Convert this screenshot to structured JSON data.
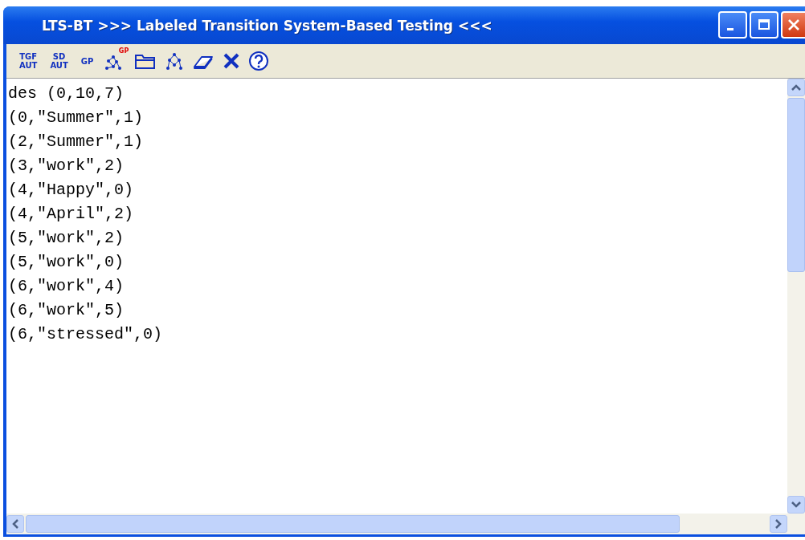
{
  "window": {
    "title": "LTS-BT >>> Labeled Transition System-Based Testing <<<"
  },
  "toolbar": [
    {
      "kind": "text",
      "lines": [
        "TGF",
        "AUT"
      ]
    },
    {
      "kind": "text",
      "lines": [
        "SD",
        "AUT"
      ]
    },
    {
      "kind": "text",
      "lines": [
        "GP"
      ]
    },
    {
      "kind": "graph-badge",
      "badge": "GP"
    },
    {
      "kind": "folder"
    },
    {
      "kind": "graph"
    },
    {
      "kind": "eraser"
    },
    {
      "kind": "close"
    },
    {
      "kind": "help"
    }
  ],
  "editor": {
    "lines": [
      "des (0,10,7)",
      "(0,\"Summer\",1)",
      "(2,\"Summer\",1)",
      "(3,\"work\",2)",
      "(4,\"Happy\",0)",
      "(4,\"April\",2)",
      "(5,\"work\",2)",
      "(5,\"work\",0)",
      "(6,\"work\",4)",
      "(6,\"work\",5)",
      "(6,\"stressed\",0)"
    ]
  }
}
